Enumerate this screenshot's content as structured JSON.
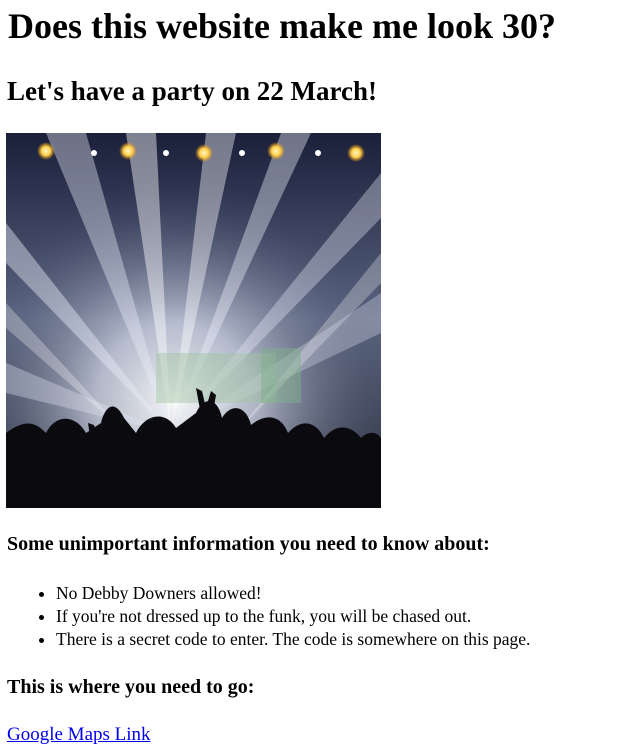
{
  "page": {
    "title": "Does this website make me look 30?",
    "subtitle": "Let's have a party on 22 March!"
  },
  "hero_image": {
    "description_icon": "concert-photo"
  },
  "info": {
    "heading": "Some unimportant information you need to know about:",
    "items": [
      "No Debby Downers allowed!",
      "If you're not dressed up to the funk, you will be chased out.",
      "There is a secret code to enter. The code is somewhere on this page."
    ]
  },
  "directions": {
    "heading": "This is where you need to go:",
    "link_text": "Google Maps Link"
  },
  "colors": {
    "link": "#0000ee",
    "text": "#000000"
  }
}
